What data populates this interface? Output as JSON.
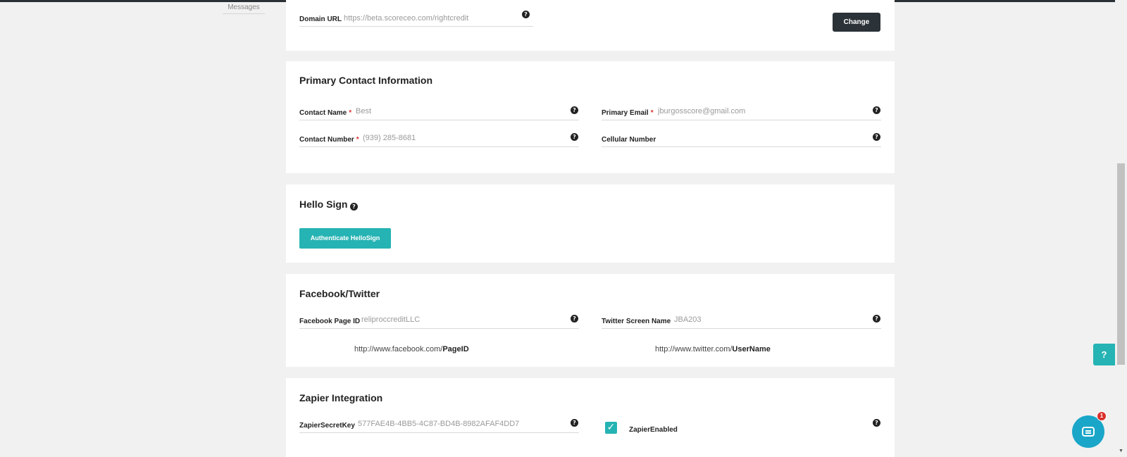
{
  "sidebar": {
    "messages_label": "Messages"
  },
  "domain": {
    "label": "Domain URL",
    "value": "https://beta.scoreceo.com/rightcredit",
    "change_button": "Change"
  },
  "primary_contact": {
    "title": "Primary Contact Information",
    "contact_name": {
      "label": "Contact Name",
      "required": "*",
      "value": "Best"
    },
    "primary_email": {
      "label": "Primary Email",
      "required": "*",
      "value": "jburgosscore@gmail.com"
    },
    "contact_number": {
      "label": "Contact Number",
      "required": "*",
      "value": "(939) 285-8681"
    },
    "cellular_number": {
      "label": "Cellular Number",
      "value": ""
    }
  },
  "hello_sign": {
    "title": "Hello Sign",
    "button": "Authenticate HelloSign"
  },
  "social": {
    "title": "Facebook/Twitter",
    "facebook": {
      "label": "Facebook Page ID",
      "value": "reliproccreditLLC",
      "hint_prefix": "http://www.facebook.com/",
      "hint_bold": "PageID"
    },
    "twitter": {
      "label": "Twitter Screen Name",
      "value": "JBA203",
      "hint_prefix": "http://www.twitter.com/",
      "hint_bold": "UserName"
    }
  },
  "zapier": {
    "title": "Zapier Integration",
    "secret_key": {
      "label": "ZapierSecretKey",
      "value": "577FAE4B-4BB5-4C87-BD4B-8982AFAF4DD7"
    },
    "enabled": {
      "label": "ZapierEnabled",
      "checked": true
    }
  },
  "widgets": {
    "help_tab": "?",
    "chat_badge": "1"
  },
  "icons": {
    "help": "question-circle-icon",
    "check": "checkmark-icon",
    "chat": "chat-icon"
  },
  "colors": {
    "accent": "#26b3b3",
    "dark_button": "#2b3238",
    "required": "#e02d2d",
    "chat": "#1aa6c8",
    "badge": "#d9302c"
  }
}
